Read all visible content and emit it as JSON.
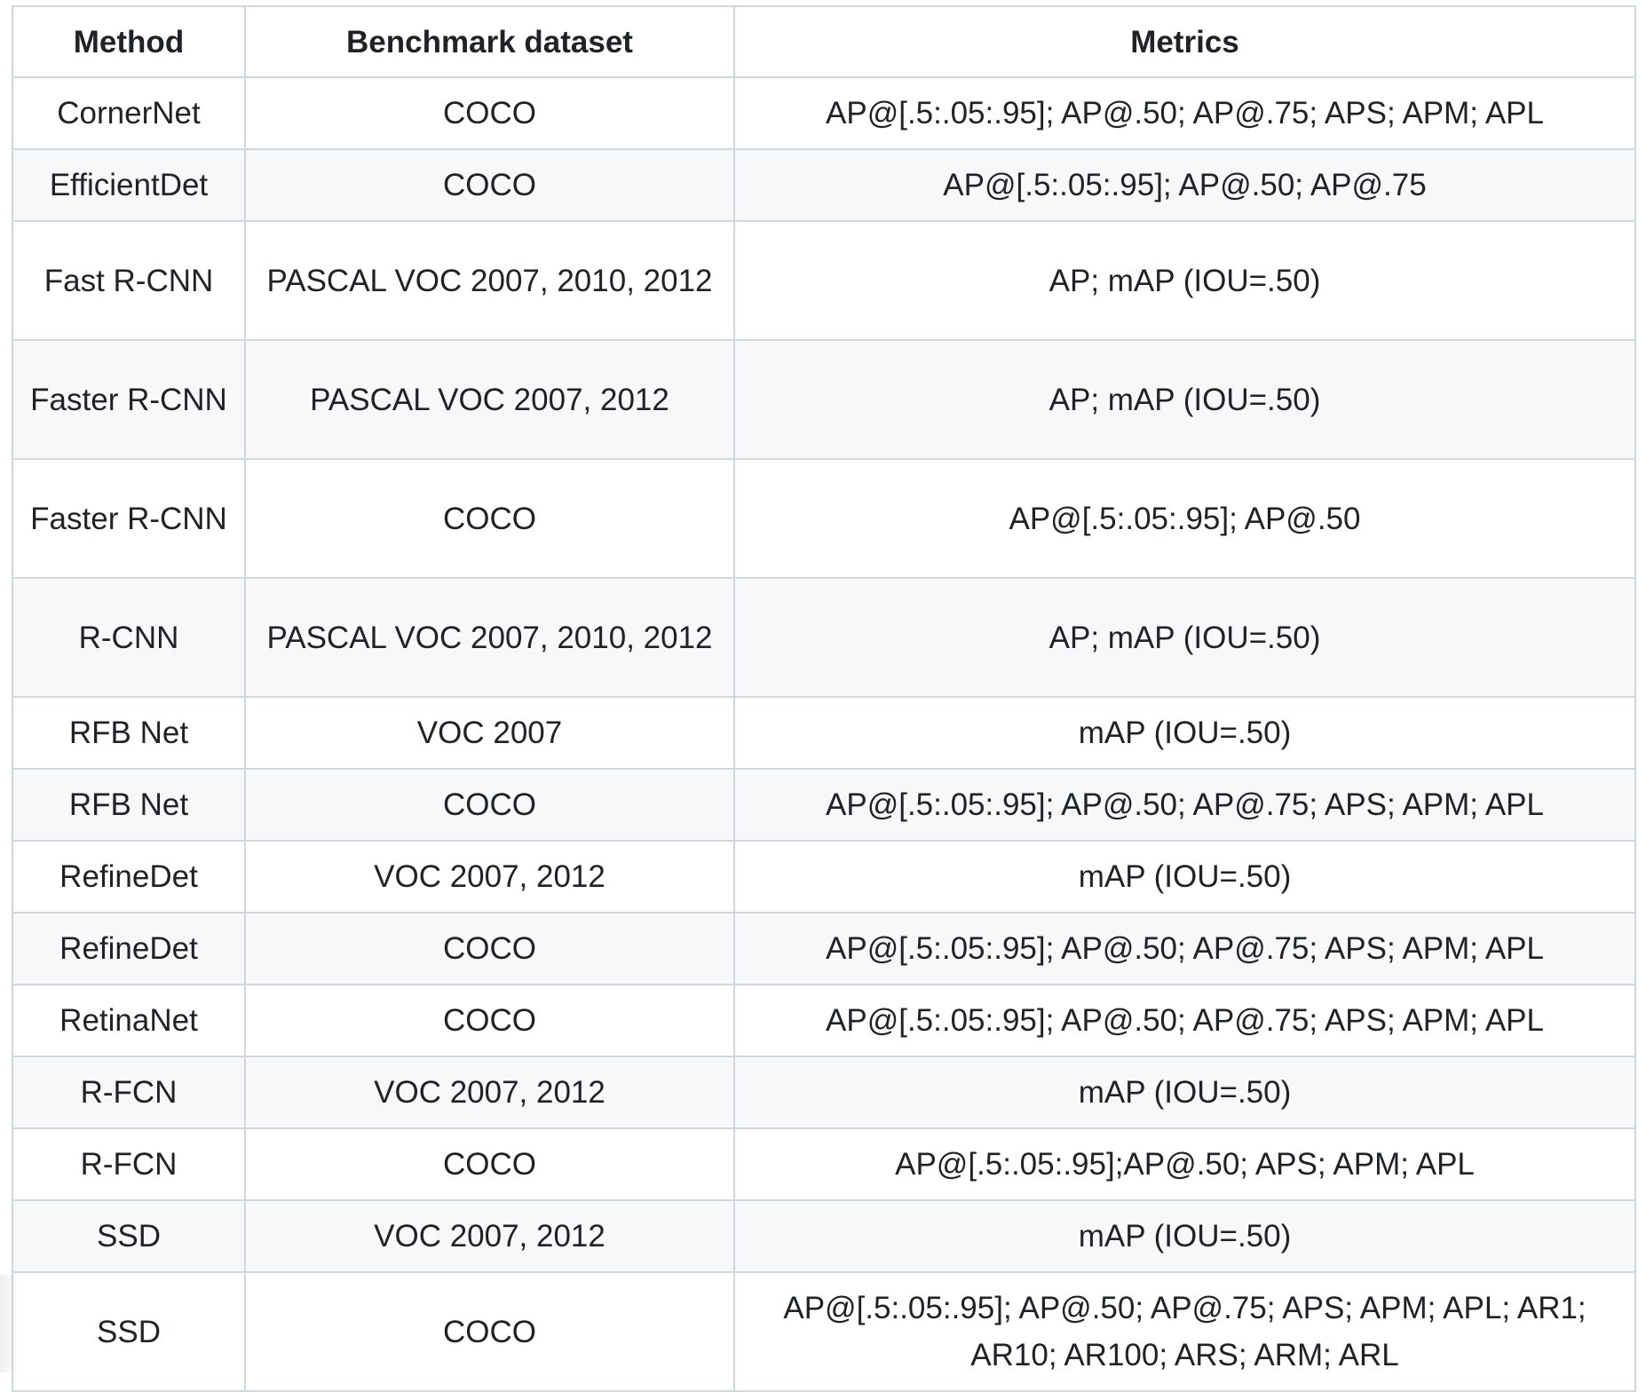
{
  "table": {
    "headers": [
      "Method",
      "Benchmark dataset",
      "Metrics"
    ],
    "rows": [
      {
        "method": "CornerNet",
        "dataset": "COCO",
        "metrics": "AP@[.5:.05:.95]; AP@.50; AP@.75; APS; APM; APL"
      },
      {
        "method": "EfficientDet",
        "dataset": "COCO",
        "metrics": "AP@[.5:.05:.95]; AP@.50; AP@.75"
      },
      {
        "method": "Fast R-CNN",
        "dataset": "PASCAL VOC 2007, 2010, 2012",
        "metrics": "AP; mAP (IOU=.50)"
      },
      {
        "method": "Faster R-CNN",
        "dataset": "PASCAL VOC 2007, 2012",
        "metrics": "AP; mAP (IOU=.50)"
      },
      {
        "method": "Faster R-CNN",
        "dataset": "COCO",
        "metrics": "AP@[.5:.05:.95]; AP@.50"
      },
      {
        "method": "R-CNN",
        "dataset": "PASCAL VOC 2007, 2010, 2012",
        "metrics": "AP; mAP (IOU=.50)"
      },
      {
        "method": "RFB Net",
        "dataset": "VOC 2007",
        "metrics": "mAP (IOU=.50)"
      },
      {
        "method": "RFB Net",
        "dataset": "COCO",
        "metrics": "AP@[.5:.05:.95]; AP@.50; AP@.75; APS; APM; APL"
      },
      {
        "method": "RefineDet",
        "dataset": "VOC 2007, 2012",
        "metrics": "mAP (IOU=.50)"
      },
      {
        "method": "RefineDet",
        "dataset": "COCO",
        "metrics": "AP@[.5:.05:.95]; AP@.50; AP@.75; APS; APM; APL"
      },
      {
        "method": "RetinaNet",
        "dataset": "COCO",
        "metrics": "AP@[.5:.05:.95]; AP@.50; AP@.75; APS; APM; APL"
      },
      {
        "method": "R-FCN",
        "dataset": "VOC 2007, 2012",
        "metrics": "mAP (IOU=.50)"
      },
      {
        "method": "R-FCN",
        "dataset": "COCO",
        "metrics": "AP@[.5:.05:.95];AP@.50; APS; APM; APL"
      },
      {
        "method": "SSD",
        "dataset": "VOC 2007, 2012",
        "metrics": "mAP (IOU=.50)"
      },
      {
        "method": "SSD",
        "dataset": "COCO",
        "metrics": "AP@[.5:.05:.95]; AP@.50; AP@.75; APS; APM; APL; AR1; AR10; AR100; ARS; ARM; ARL"
      }
    ]
  }
}
